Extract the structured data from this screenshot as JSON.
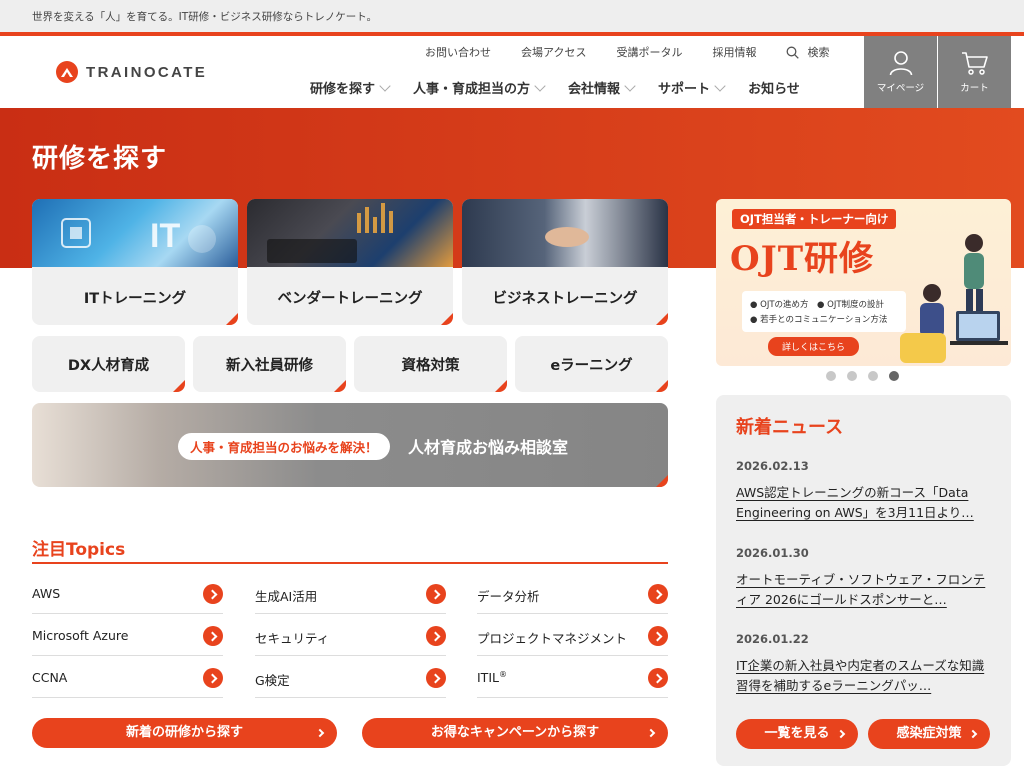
{
  "topbar": {
    "tagline": "世界を変える「人」を育てる。IT研修・ビジネス研修ならトレノケート。"
  },
  "header": {
    "logo_text": "TRAINOCATE",
    "util_nav": [
      "お問い合わせ",
      "会場アクセス",
      "受講ポータル",
      "採用情報"
    ],
    "search_label": "検索",
    "main_nav": [
      {
        "label": "研修を探す",
        "dropdown": true
      },
      {
        "label": "人事・育成担当の方",
        "dropdown": true
      },
      {
        "label": "会社情報",
        "dropdown": true
      },
      {
        "label": "サポート",
        "dropdown": true
      },
      {
        "label": "お知らせ",
        "dropdown": false
      }
    ],
    "mypage_label": "マイページ",
    "cart_label": "カート"
  },
  "hero": {
    "title": "研修を探す"
  },
  "categories_big": [
    {
      "label": "ITトレーニング",
      "photo": "it-photo"
    },
    {
      "label": "ベンダートレーニング",
      "photo": "vendor-photo"
    },
    {
      "label": "ビジネストレーニング",
      "photo": "business-photo"
    }
  ],
  "categories_small": [
    "DX人材育成",
    "新入社員研修",
    "資格対策",
    "eラーニング"
  ],
  "consult": {
    "pill": "人事・育成担当のお悩みを解決！",
    "title": "人材育成お悩み相談室"
  },
  "topics": {
    "title": "注目Topics",
    "items": [
      "AWS",
      "生成AI活用",
      "データ分析",
      "Microsoft Azure",
      "セキュリティ",
      "プロジェクトマネジメント",
      "CCNA",
      "G検定",
      "ITIL"
    ],
    "itil_sup": "®"
  },
  "buttons": {
    "new_courses": "新着の研修から探す",
    "campaign": "お得なキャンペーンから探す"
  },
  "banner": {
    "sub": "OJT担当者・トレーナー向け",
    "title": "OJT研修",
    "points": [
      "OJTの進め方",
      "OJT制度の設計",
      "若手とのコミュニケーション方法"
    ],
    "more": "詳しくはこちら",
    "slides": 4,
    "active_slide": 4
  },
  "news": {
    "title": "新着ニュース",
    "items": [
      {
        "date": "2026.02.13",
        "text": "AWS認定トレーニングの新コース「Data Engineering on AWS」を3月11日より…"
      },
      {
        "date": "2026.01.30",
        "text": "オートモーティブ・ソフトウェア・フロンティア 2026にゴールドスポンサーと…"
      },
      {
        "date": "2026.01.22",
        "text": "IT企業の新入社員や内定者のスムーズな知識習得を補助するeラーニングパッ…"
      }
    ],
    "list_btn": "一覧を見る",
    "infection_btn": "感染症対策"
  },
  "colors": {
    "accent": "#e8431d",
    "hero_dark": "#c92e14",
    "header_btn": "#808080"
  }
}
